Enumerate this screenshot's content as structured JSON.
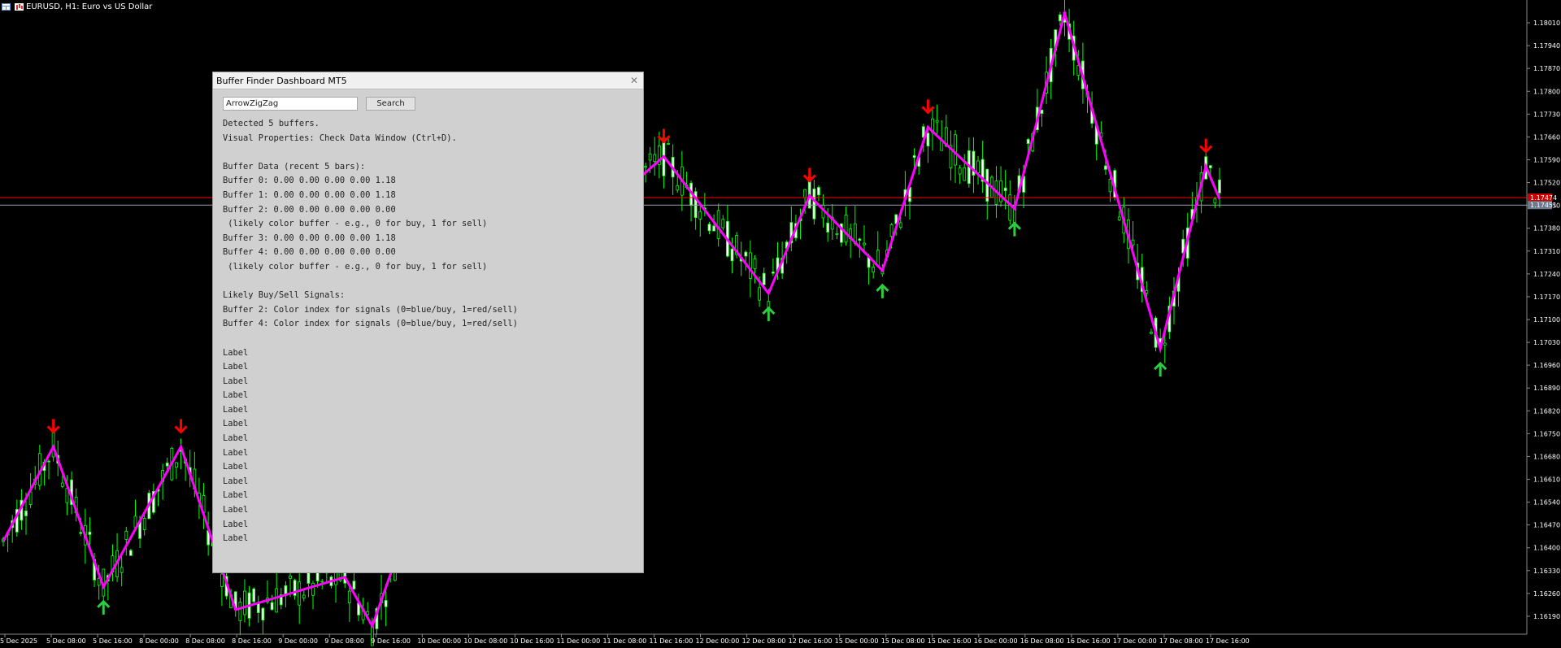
{
  "window": {
    "title": "EURUSD, H1: Euro vs US Dollar"
  },
  "panel": {
    "title": "Buffer Finder Dashboard MT5",
    "close_icon": "close-icon",
    "search_value": "ArrowZigZag",
    "search_button": "Search",
    "lines": [
      "Detected 5 buffers.",
      "Visual Properties: Check Data Window (Ctrl+D).",
      "",
      "Buffer Data (recent 5 bars):",
      "Buffer 0: 0.00 0.00 0.00 0.00 1.18",
      "Buffer 1: 0.00 0.00 0.00 0.00 1.18",
      "Buffer 2: 0.00 0.00 0.00 0.00 0.00",
      " (likely color buffer - e.g., 0 for buy, 1 for sell)",
      "Buffer 3: 0.00 0.00 0.00 0.00 1.18",
      "Buffer 4: 0.00 0.00 0.00 0.00 0.00",
      " (likely color buffer - e.g., 0 for buy, 1 for sell)",
      "",
      "Likely Buy/Sell Signals:",
      "Buffer 2: Color index for signals (0=blue/buy, 1=red/sell)",
      "Buffer 4: Color index for signals (0=blue/buy, 1=red/sell)",
      "",
      "Label",
      "Label",
      "Label",
      "Label",
      "Label",
      "Label",
      "Label",
      "Label",
      "Label",
      "Label",
      "Label",
      "Label",
      "Label",
      "Label"
    ]
  },
  "chart": {
    "symbol": "EURUSD",
    "timeframe": "H1",
    "price_labels": [
      "1.18010",
      "1.17940",
      "1.17870",
      "1.17800",
      "1.17730",
      "1.17660",
      "1.17590",
      "1.17520",
      "1.17450",
      "1.17380",
      "1.17310",
      "1.17240",
      "1.17170",
      "1.17100",
      "1.17030",
      "1.16960",
      "1.16890",
      "1.16820",
      "1.16750",
      "1.16680",
      "1.16610",
      "1.16540",
      "1.16470",
      "1.16400",
      "1.16330",
      "1.16260",
      "1.16190"
    ],
    "price_range": [
      1.1616,
      1.1805
    ],
    "current_bid": "1.17474",
    "current_ask": "1.17451",
    "time_labels": [
      "5 Dec 2025",
      "5 Dec 08:00",
      "5 Dec 16:00",
      "8 Dec 00:00",
      "8 Dec 08:00",
      "8 Dec 16:00",
      "9 Dec 00:00",
      "9 Dec 08:00",
      "9 Dec 16:00",
      "10 Dec 00:00",
      "10 Dec 08:00",
      "10 Dec 16:00",
      "11 Dec 00:00",
      "11 Dec 08:00",
      "11 Dec 16:00",
      "12 Dec 00:00",
      "12 Dec 08:00",
      "12 Dec 16:00",
      "15 Dec 00:00",
      "15 Dec 08:00",
      "15 Dec 16:00",
      "16 Dec 00:00",
      "16 Dec 08:00",
      "16 Dec 16:00",
      "17 Dec 00:00",
      "17 Dec 08:00",
      "17 Dec 16:00"
    ],
    "colors": {
      "background": "#000000",
      "bull_candle": "#00ff00",
      "bear_candle": "#ffffff",
      "zigzag": "#ff00ff",
      "sell_arrow": "#ff0000",
      "buy_arrow": "#2ecc40",
      "bid_line": "#ff0000",
      "ask_line": "#9aa3b0",
      "axis_text": "#ffffff"
    },
    "zigzag_points": [
      {
        "bar": 0,
        "price": 1.1642
      },
      {
        "bar": 11,
        "price": 1.1671
      },
      {
        "bar": 22,
        "price": 1.1628
      },
      {
        "bar": 39,
        "price": 1.1671
      },
      {
        "bar": 51,
        "price": 1.1621
      },
      {
        "bar": 75,
        "price": 1.1631
      },
      {
        "bar": 81,
        "price": 1.1616
      },
      {
        "bar": 105,
        "price": 1.1711
      },
      {
        "bar": 145,
        "price": 1.176
      },
      {
        "bar": 168,
        "price": 1.1718
      },
      {
        "bar": 177,
        "price": 1.1748
      },
      {
        "bar": 193,
        "price": 1.1725
      },
      {
        "bar": 203,
        "price": 1.1769
      },
      {
        "bar": 222,
        "price": 1.1744
      },
      {
        "bar": 233,
        "price": 1.1804
      },
      {
        "bar": 254,
        "price": 1.1701
      },
      {
        "bar": 264,
        "price": 1.1757
      },
      {
        "bar": 267,
        "price": 1.1747
      }
    ],
    "sell_arrows": [
      {
        "bar": 11,
        "price": 1.1671
      },
      {
        "bar": 39,
        "price": 1.1671
      },
      {
        "bar": 145,
        "price": 1.176
      },
      {
        "bar": 177,
        "price": 1.1748
      },
      {
        "bar": 203,
        "price": 1.1769
      },
      {
        "bar": 264,
        "price": 1.1757
      }
    ],
    "buy_arrows": [
      {
        "bar": 22,
        "price": 1.1628
      },
      {
        "bar": 168,
        "price": 1.1718
      },
      {
        "bar": 193,
        "price": 1.1725
      },
      {
        "bar": 222,
        "price": 1.1744
      },
      {
        "bar": 254,
        "price": 1.1701
      }
    ],
    "total_bars": 268
  }
}
